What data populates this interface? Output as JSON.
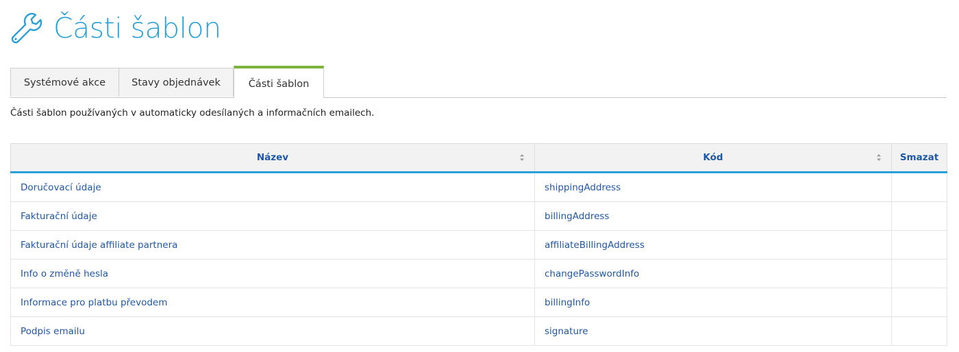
{
  "page": {
    "title": "Části šablon",
    "icon": "wrench-icon",
    "accent_color": "#2a9fd8",
    "tab_active_color": "#7bb33c"
  },
  "tabs": [
    {
      "label": "Systémové akce",
      "active": false
    },
    {
      "label": "Stavy objednávek",
      "active": false
    },
    {
      "label": "Části šablon",
      "active": true
    }
  ],
  "description": "Části šablon používaných v automaticky odesílaných a informačních emailech.",
  "table": {
    "columns": [
      {
        "label": "Název",
        "sortable": true
      },
      {
        "label": "Kód",
        "sortable": true
      },
      {
        "label": "Smazat",
        "sortable": false
      }
    ],
    "rows": [
      {
        "name": "Doručovací údaje",
        "code": "shippingAddress"
      },
      {
        "name": "Fakturační údaje",
        "code": "billingAddress"
      },
      {
        "name": "Fakturační údaje affiliate partnera",
        "code": "affiliateBillingAddress"
      },
      {
        "name": "Info o změně hesla",
        "code": "changePasswordInfo"
      },
      {
        "name": "Informace pro platbu převodem",
        "code": "billingInfo"
      },
      {
        "name": "Podpis emailu",
        "code": "signature"
      }
    ]
  }
}
